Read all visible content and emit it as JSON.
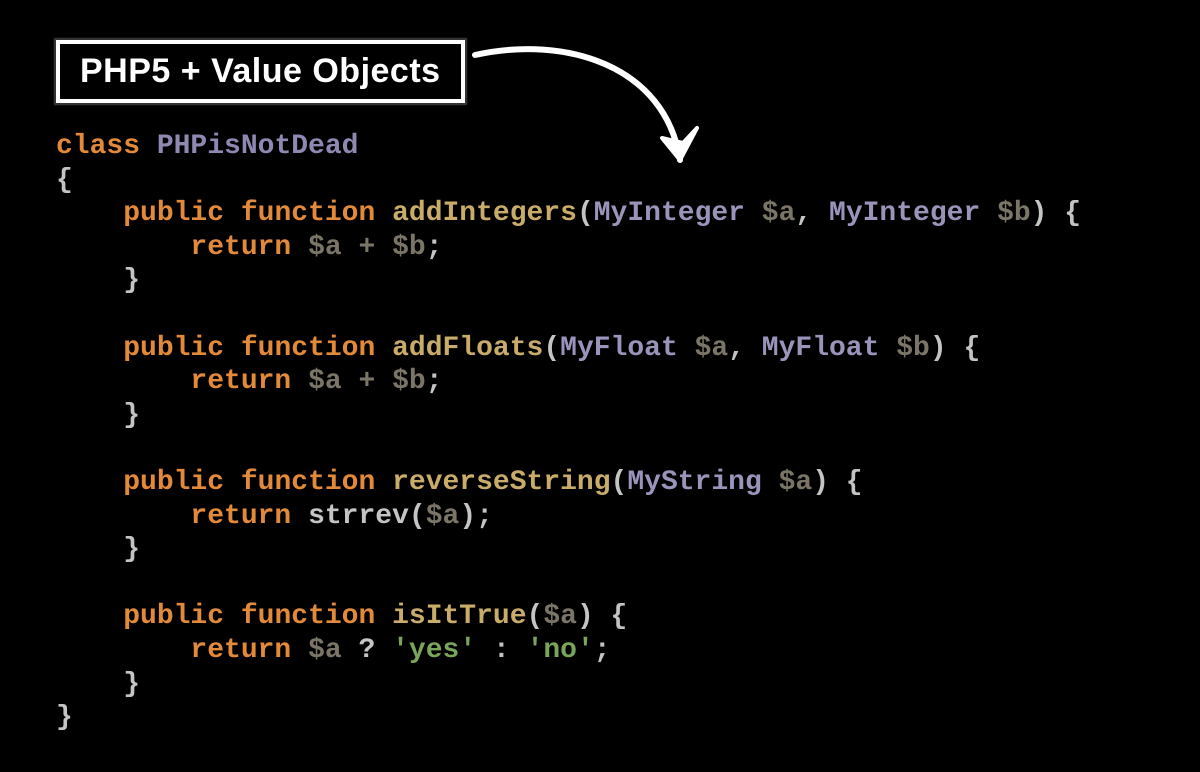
{
  "title": "PHP5 + Value Objects",
  "code": {
    "kw_class": "class",
    "class_name": "PHPisNotDead",
    "kw_public": "public",
    "kw_function": "function",
    "kw_return": "return",
    "m1": {
      "name": "addIntegers",
      "t": "MyInteger",
      "p1": "$a",
      "p2": "$b",
      "body": "$a + $b"
    },
    "m2": {
      "name": "addFloats",
      "t": "MyFloat",
      "p1": "$a",
      "p2": "$b",
      "body": "$a + $b"
    },
    "m3": {
      "name": "reverseString",
      "t": "MyString",
      "p1": "$a",
      "call": "strrev",
      "arg": "$a"
    },
    "m4": {
      "name": "isItTrue",
      "p1": "$a",
      "cond": "$a",
      "true": "'yes'",
      "false": "'no'"
    }
  }
}
